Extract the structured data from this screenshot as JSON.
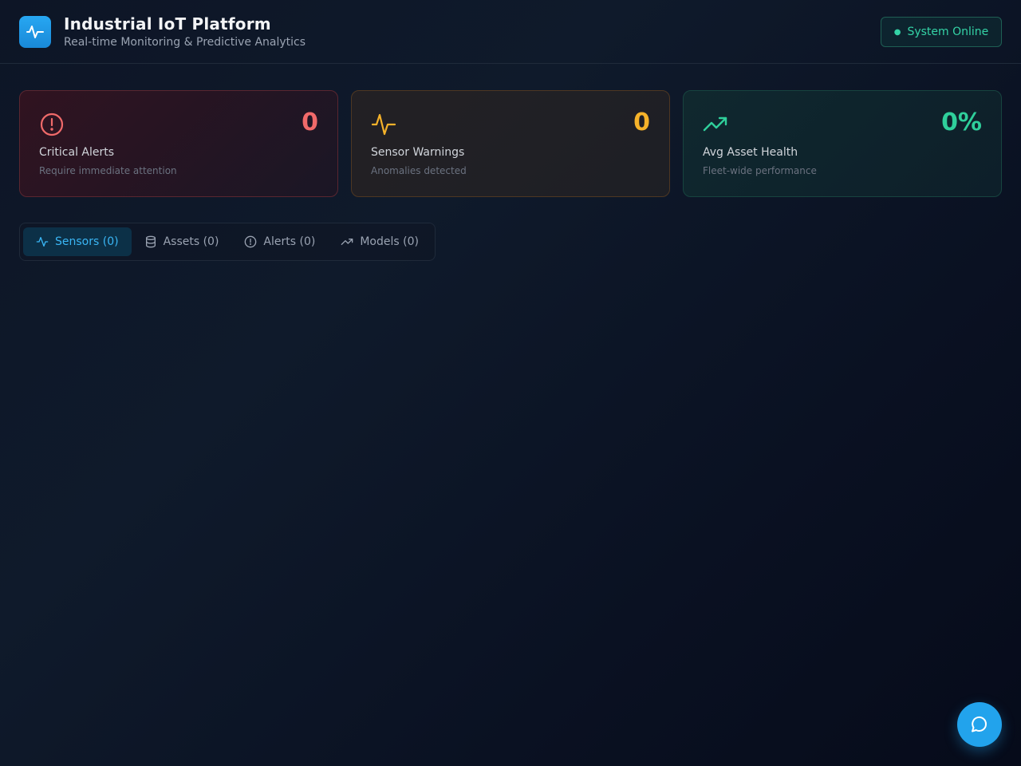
{
  "header": {
    "title": "Industrial IoT Platform",
    "subtitle": "Real-time Monitoring & Predictive Analytics",
    "status": "System Online"
  },
  "cards": [
    {
      "value": "0",
      "label": "Critical Alerts",
      "sub": "Require immediate attention",
      "color": "#f06a6a",
      "icon": "alert-circle-icon"
    },
    {
      "value": "0",
      "label": "Sensor Warnings",
      "sub": "Anomalies detected",
      "color": "#f5b22a",
      "icon": "activity-icon"
    },
    {
      "value": "0%",
      "label": "Avg Asset Health",
      "sub": "Fleet-wide performance",
      "color": "#2fcf9b",
      "icon": "trending-up-icon"
    }
  ],
  "tabs": [
    {
      "label": "Sensors (0)",
      "icon": "activity-icon",
      "active": true
    },
    {
      "label": "Assets (0)",
      "icon": "database-icon",
      "active": false
    },
    {
      "label": "Alerts (0)",
      "icon": "alert-circle-icon",
      "active": false
    },
    {
      "label": "Models (0)",
      "icon": "trending-up-icon",
      "active": false
    }
  ],
  "colors": {
    "accent": "#1d9bf0",
    "online": "#34d3a6"
  }
}
